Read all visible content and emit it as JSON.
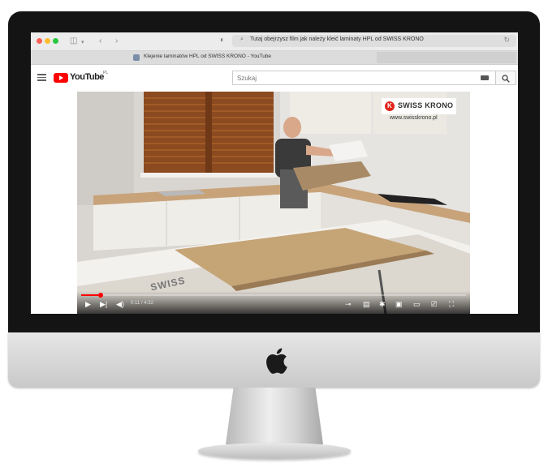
{
  "browser": {
    "address_text": "Tutaj obejrzysz film jak należy kleić laminaty HPL od SWISS KRONO",
    "tab_title": "Klejenie laminatów HPL od SWISS KRONO - YouTube"
  },
  "youtube": {
    "logo_text": "YouTube",
    "region": "PL",
    "search_placeholder": "Szukaj"
  },
  "video": {
    "brand_name": "SWISS KRONO",
    "brand_url": "www.swisskrono.pl",
    "floor_label": "SWISS",
    "time": "0:11 / 4:32",
    "progress": 0.05,
    "colors": {
      "accent": "#ff0000",
      "brand": "#e2231a"
    }
  },
  "icons": [
    "hamburger-icon",
    "search-icon",
    "keyboard-icon",
    "play-icon",
    "next-icon",
    "volume-icon",
    "autoplay-icon",
    "subtitles-icon",
    "settings-icon",
    "miniplayer-icon",
    "theater-icon",
    "cast-icon",
    "fullscreen-icon",
    "apple-logo-icon"
  ]
}
